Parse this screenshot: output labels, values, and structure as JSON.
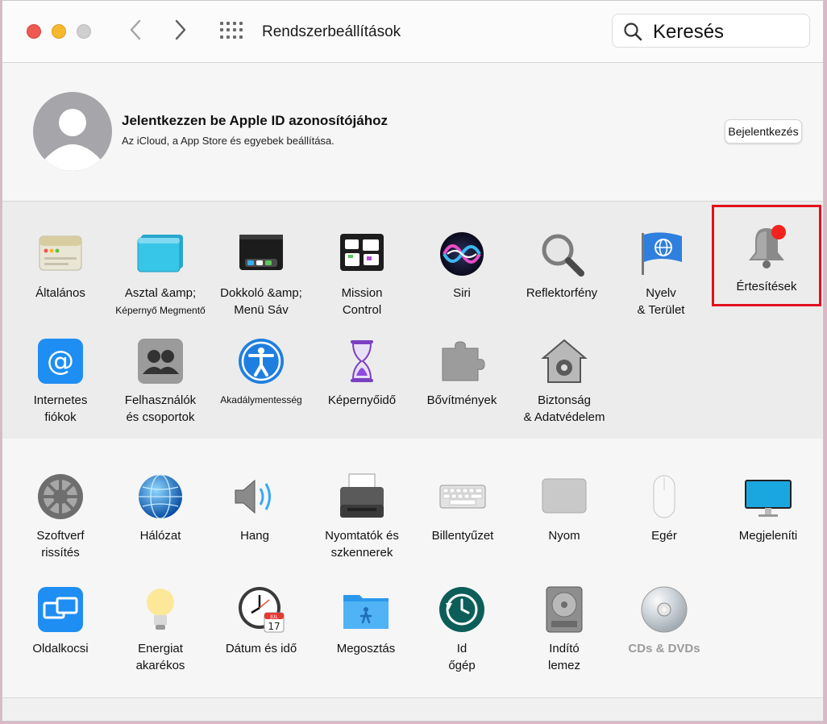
{
  "window": {
    "title": "Rendszerbeállítások"
  },
  "search": {
    "placeholder": "Keresés"
  },
  "account": {
    "title": "Jelentkezzen be Apple ID azonosítójához",
    "subtitle": "Az iCloud, a App Store és egyebek beállítása.",
    "signin_label": "Bejelentkezés"
  },
  "colors": {
    "traffic_red": "#ee5a50",
    "traffic_yellow": "#f6b82f",
    "traffic_gray": "#cfcfcf",
    "highlight": "#e3101e"
  },
  "section1": [
    {
      "label1": "Általános",
      "label2": "",
      "icon": "general-icon"
    },
    {
      "label1": "Asztal &amp;",
      "label2": "Képernyő Megmentő",
      "icon": "desktop-screensaver-icon"
    },
    {
      "label1": "Dokkoló &amp;",
      "label2": "Menü Sáv",
      "icon": "dock-menubar-icon"
    },
    {
      "label1": "Mission",
      "label2": "Control",
      "icon": "mission-control-icon"
    },
    {
      "label1": "Siri",
      "label2": "",
      "icon": "siri-icon"
    },
    {
      "label1": "Reflektorfény",
      "label2": "",
      "icon": "spotlight-icon"
    },
    {
      "label1": "Nyelv",
      "label2": "& Terület",
      "icon": "language-region-icon"
    },
    {
      "label1": "Értesítések",
      "label2": "",
      "icon": "notifications-icon"
    },
    {
      "label1": "Internetes",
      "label2": "fiókok",
      "icon": "internet-accounts-icon"
    },
    {
      "label1": "Felhasználók",
      "label2": "és csoportok",
      "icon": "users-groups-icon"
    },
    {
      "label1": "Akadálymentesség",
      "label2": "",
      "icon": "accessibility-icon"
    },
    {
      "label1": "Képernyőidő",
      "label2": "",
      "icon": "screen-time-icon"
    },
    {
      "label1": "Bővítmények",
      "label2": "",
      "icon": "extensions-icon"
    },
    {
      "label1": "Biztonság",
      "label2": "& Adatvédelem",
      "icon": "security-privacy-icon"
    }
  ],
  "section2": [
    {
      "label1": "Szoftverf",
      "label2": "rissítés",
      "icon": "software-update-icon"
    },
    {
      "label1": "Hálózat",
      "label2": "",
      "icon": "network-icon"
    },
    {
      "label1": "Hang",
      "label2": "",
      "icon": "sound-icon"
    },
    {
      "label1": "Nyomtatók és",
      "label2": "szkennerek",
      "icon": "printers-scanners-icon"
    },
    {
      "label1": "Billentyűzet",
      "label2": "",
      "icon": "keyboard-icon"
    },
    {
      "label1": "Nyom",
      "label2": "",
      "icon": "trackpad-icon"
    },
    {
      "label1": "Egér",
      "label2": "",
      "icon": "mouse-icon"
    },
    {
      "label1": "Megjeleníti",
      "label2": "",
      "icon": "displays-icon"
    },
    {
      "label1": "Oldalkocsi",
      "label2": "",
      "icon": "sidecar-icon"
    },
    {
      "label1": "Energiat",
      "label2": "akarékos",
      "icon": "energy-saver-icon"
    },
    {
      "label1": "Dátum és idő",
      "label2": "",
      "icon": "date-time-icon"
    },
    {
      "label1": "Megosztás",
      "label2": "",
      "icon": "sharing-icon"
    },
    {
      "label1": "Id",
      "label2": "őgép",
      "icon": "time-machine-icon"
    },
    {
      "label1": "Indító",
      "label2": "lemez",
      "icon": "startup-disk-icon"
    },
    {
      "label1": "CDs & DVDs",
      "label2": "",
      "icon": "cds-dvds-icon"
    }
  ],
  "calendar_icon": {
    "month": "JUL",
    "day": "17"
  }
}
